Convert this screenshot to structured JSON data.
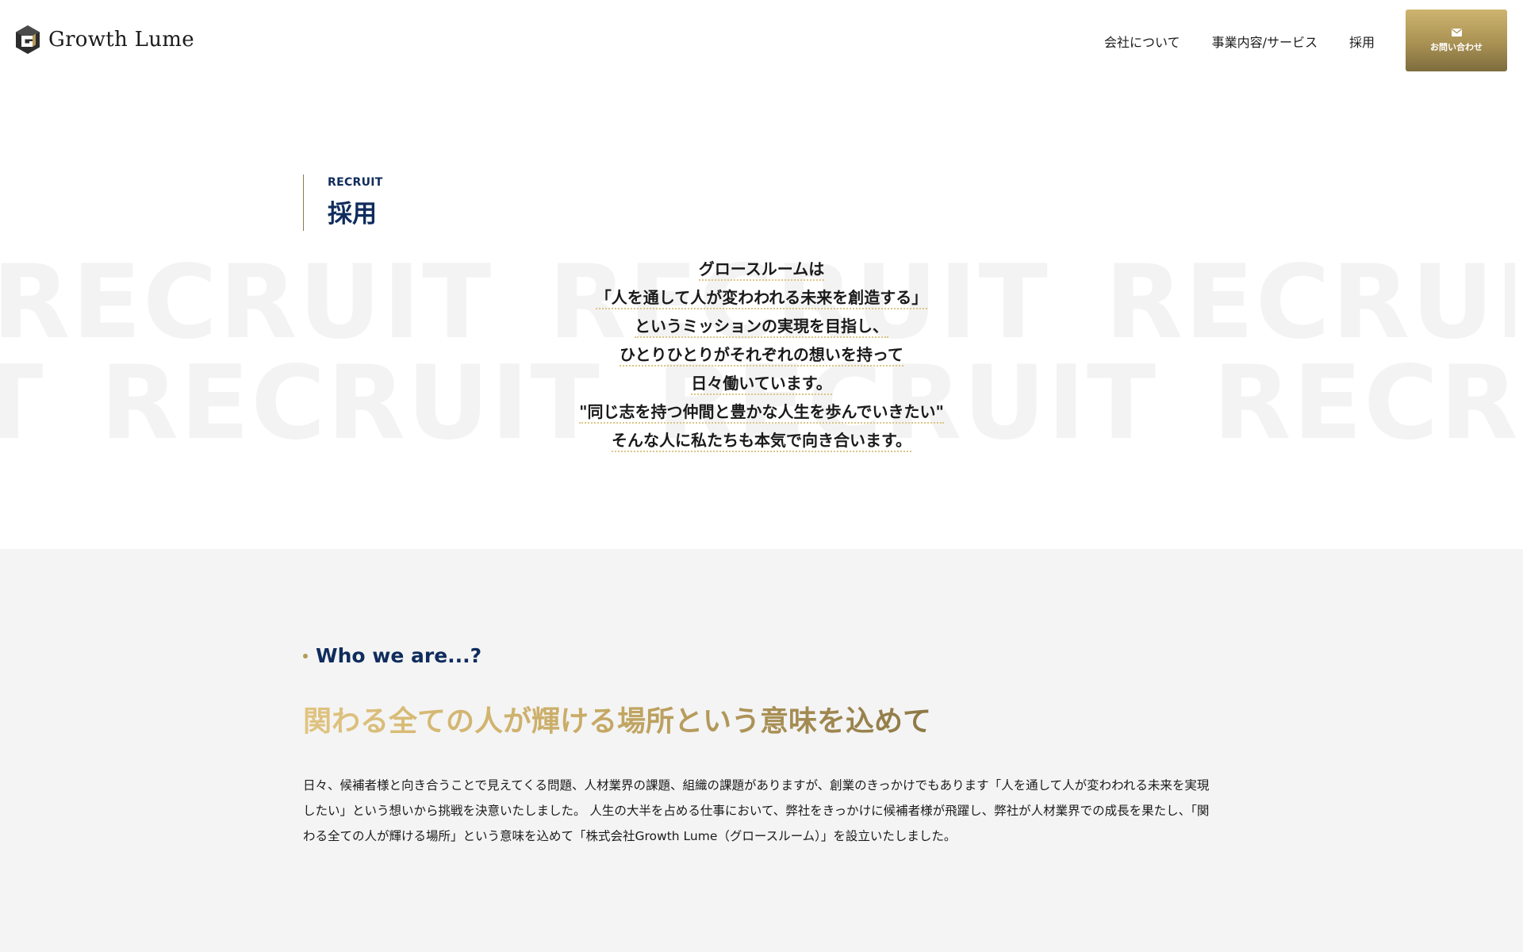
{
  "header": {
    "logo_text": "Growth Lume",
    "logo_icon": "hexagon-logo-icon",
    "nav": [
      {
        "label": "会社について"
      },
      {
        "label": "事業内容/サービス"
      },
      {
        "label": "採用"
      }
    ],
    "contact": {
      "label": "お問い合わせ",
      "icon": "mail-icon"
    }
  },
  "watermark_word": "RECRUIT",
  "title": {
    "en": "RECRUIT",
    "ja": "採用"
  },
  "mission_lines": [
    "グロースルームは",
    "「人を通して人が変わわれる未来を創造する」",
    "というミッションの実現を目指し、",
    "ひとりひとりがそれぞれの想いを持って",
    "日々働いています。",
    "\"同じ志を持つ仲間と豊かな人生を歩んでいきたい\"",
    "そんな人に私たちも本気で向き合います。"
  ],
  "about": {
    "subtitle": "Who we are...?",
    "lead": "関わる全ての人が輝ける場所という意味を込めて",
    "body": "日々、候補者様と向き合うことで見えてくる問題、人材業界の課題、組織の課題がありますが、創業のきっかけでもあります「人を通して人が変わわれる未来を実現したい」という想いから挑戦を決意いたしました。 人生の大半を占める仕事において、弊社をきっかけに候補者様が飛躍し、弊社が人材業界での成長を果たし、「関わる全ての人が輝ける場所」という意味を込めて「株式会社Growth Lume（グロースルーム）」を設立いたしました。"
  },
  "colors": {
    "navy": "#0f2c5c",
    "gold": "#b49a59",
    "section_bg": "#f4f4f4"
  }
}
